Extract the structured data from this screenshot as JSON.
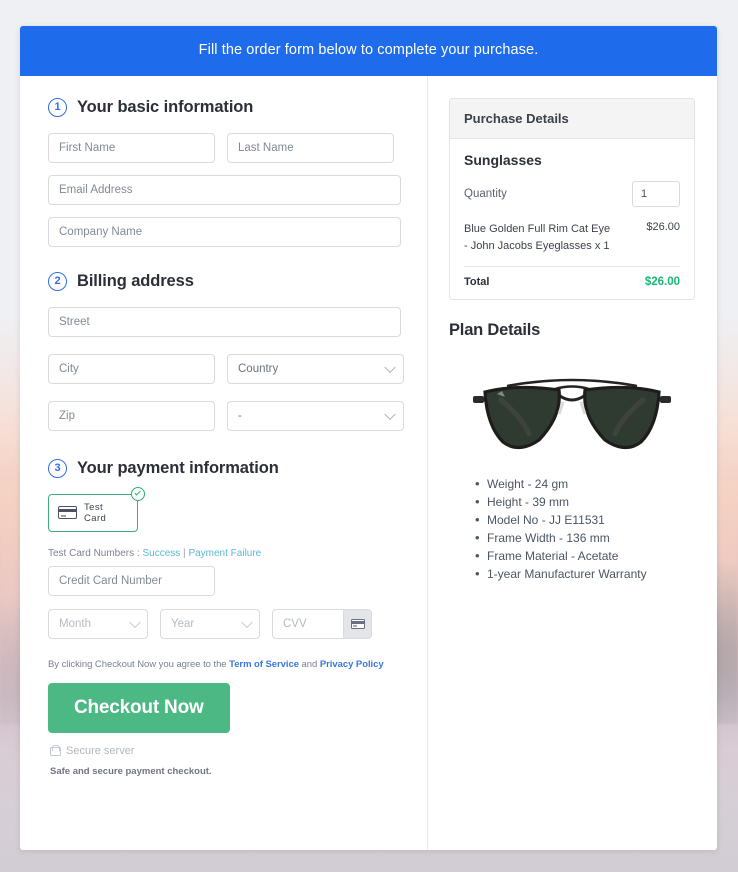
{
  "banner": {
    "text": "Fill the order form below to complete your purchase."
  },
  "sections": {
    "basic": {
      "step": "1",
      "title": "Your basic information",
      "fields": {
        "first_name": "First Name",
        "last_name": "Last Name",
        "email": "Email Address",
        "company": "Company Name"
      }
    },
    "billing": {
      "step": "2",
      "title": "Billing address",
      "fields": {
        "street": "Street",
        "city": "City",
        "country": "Country",
        "zip": "Zip",
        "state": "-"
      }
    },
    "payment": {
      "step": "3",
      "title": "Your payment information",
      "method_label": "Test  Card",
      "test_prefix": "Test Card Numbers : ",
      "test_success": "Success",
      "test_separator": " | ",
      "test_failure": "Payment Failure",
      "fields": {
        "card_number": "Credit Card Number",
        "month": "Month",
        "year": "Year",
        "cvv": "CVV"
      }
    }
  },
  "footer": {
    "terms_prefix": "By clicking Checkout Now you agree to the ",
    "terms_link": "Term of Service",
    "terms_mid": " and ",
    "privacy_link": "Privacy Policy",
    "checkout_button": "Checkout Now",
    "secure_server": "Secure server",
    "safe_note": "Safe and secure payment checkout."
  },
  "purchase": {
    "heading": "Purchase Details",
    "product_title": "Sunglasses",
    "quantity_label": "Quantity",
    "quantity_value": "1",
    "item_name": "Blue Golden Full Rim Cat Eye - John Jacobs Eyeglasses x 1",
    "item_price": "$26.00",
    "total_label": "Total",
    "total_value": "$26.00",
    "total_color": "#17b871"
  },
  "plan": {
    "heading": "Plan Details",
    "features": [
      "Weight - 24 gm",
      "Height - 39 mm",
      "Model No - JJ E11531",
      "Frame Width - 136 mm",
      "Frame Material - Acetate",
      "1-year Manufacturer Warranty"
    ]
  },
  "colors": {
    "banner_blue": "#1e6beb",
    "accent_green": "#4cb883",
    "step_blue": "#2f6fe4",
    "link_blue": "#3b78dd",
    "test_link": "#5bb9d4"
  }
}
